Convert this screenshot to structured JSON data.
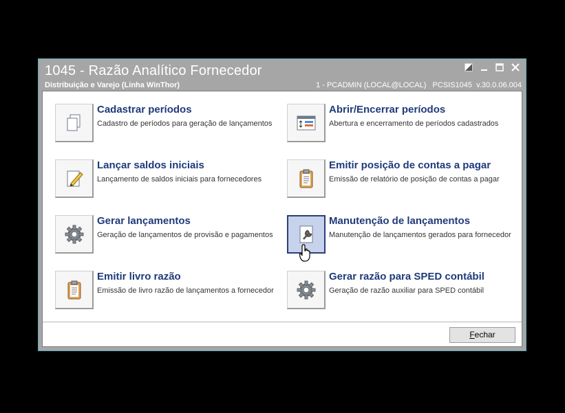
{
  "window": {
    "title": "1045 - Razão Analítico Fornecedor",
    "subtitle": "Distribuição e Varejo (Linha WinThor)",
    "info": "1 - PCADMIN (LOCAL@LOCAL)   PCSIS1045  v.30.0.06.004"
  },
  "items": [
    {
      "title": "Cadastrar períodos",
      "desc": "Cadastro de períodos para geração de lançamentos",
      "icon": "copy-documents-icon"
    },
    {
      "title": "Abrir/Encerrar períodos",
      "desc": "Abertura e encerramento de períodos cadastrados",
      "icon": "form-window-icon"
    },
    {
      "title": "Lançar saldos iniciais",
      "desc": "Lançamento de saldos iniciais para fornecedores",
      "icon": "edit-document-icon"
    },
    {
      "title": "Emitir posição de contas a pagar",
      "desc": "Emissão de relatório de posição de contas a pagar",
      "icon": "clipboard-icon"
    },
    {
      "title": "Gerar lançamentos",
      "desc": "Geração de lançamentos de provisão e pagamentos",
      "icon": "gear-icon"
    },
    {
      "title": "Manutenção de lançamentos",
      "desc": "Manutenção de lançamentos gerados para fornecedor",
      "icon": "wrench-document-icon"
    },
    {
      "title": "Emitir livro razão",
      "desc": "Emissão de livro razão de lançamentos a fornecedor",
      "icon": "clipboard-icon"
    },
    {
      "title": "Gerar razão para SPED contábil",
      "desc": "Geração de razão auxiliar para SPED contábil",
      "icon": "gear-icon"
    }
  ],
  "footer": {
    "close_label_accel": "F",
    "close_label_rest": "echar"
  }
}
